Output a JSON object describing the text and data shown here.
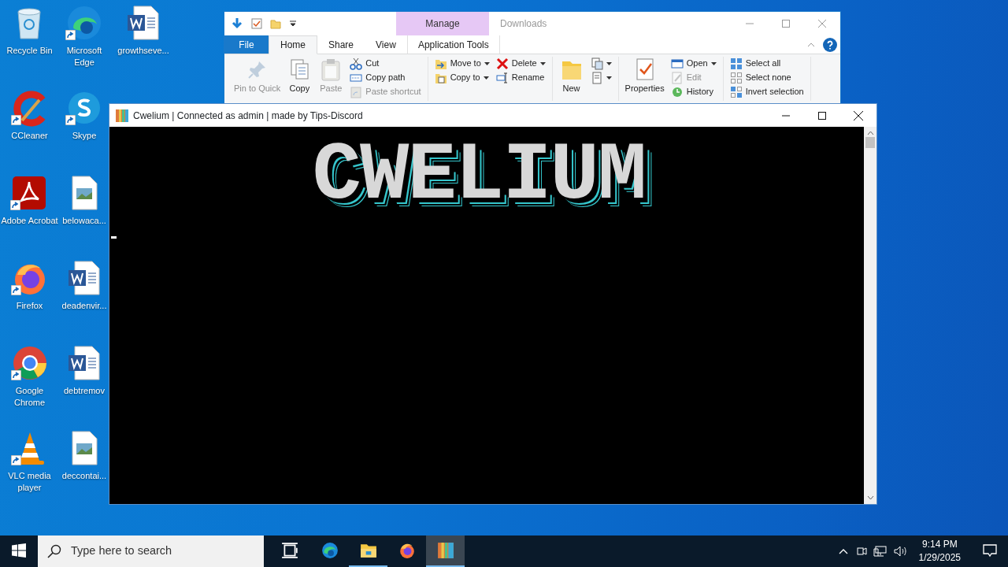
{
  "desktop_icons": [
    {
      "label": "Recycle Bin",
      "kind": "recycle",
      "shortcut": false
    },
    {
      "label": "CCleaner",
      "kind": "ccleaner",
      "shortcut": true
    },
    {
      "label": "Adobe Acrobat",
      "kind": "acrobat",
      "shortcut": true
    },
    {
      "label": "Firefox",
      "kind": "firefox",
      "shortcut": true
    },
    {
      "label": "Google Chrome",
      "kind": "chrome",
      "shortcut": true
    },
    {
      "label": "VLC media player",
      "kind": "vlc",
      "shortcut": true
    },
    {
      "label": "Microsoft Edge",
      "kind": "edge",
      "shortcut": true
    },
    {
      "label": "Skype",
      "kind": "skype",
      "shortcut": true
    },
    {
      "label": "belowaca...",
      "kind": "image",
      "shortcut": false
    },
    {
      "label": "deadenvir...",
      "kind": "word",
      "shortcut": false
    },
    {
      "label": "debtremov",
      "kind": "word",
      "shortcut": false
    },
    {
      "label": "deccontai...",
      "kind": "image",
      "shortcut": false
    },
    {
      "label": "growthseve...",
      "kind": "word",
      "shortcut": false
    }
  ],
  "explorer": {
    "title": "Downloads",
    "context_header": "Manage",
    "tabs": [
      {
        "label": "File",
        "kind": "file",
        "selected": false
      },
      {
        "label": "Home",
        "kind": "tab",
        "selected": true
      },
      {
        "label": "Share",
        "kind": "tab",
        "selected": false
      },
      {
        "label": "View",
        "kind": "tab",
        "selected": false
      },
      {
        "label": "Application Tools",
        "kind": "context",
        "selected": false
      }
    ],
    "groups": [
      {
        "columns": [
          [
            {
              "label": "Pin to Quick",
              "kind": "pin",
              "disabled": true,
              "dropdown": false
            }
          ],
          [
            {
              "label": "Copy",
              "kind": "copy",
              "disabled": false,
              "dropdown": false
            }
          ],
          [
            {
              "label": "Paste",
              "kind": "paste",
              "disabled": true,
              "dropdown": false
            }
          ],
          [
            {
              "label": "Cut",
              "kind": "cut",
              "disabled": false,
              "dropdown": false
            },
            {
              "label": "Copy path",
              "kind": "copypath",
              "disabled": false,
              "dropdown": false
            },
            {
              "label": "Paste shortcut",
              "kind": "pasteshortcut",
              "disabled": true,
              "dropdown": false
            }
          ]
        ]
      },
      {
        "columns": [
          [
            {
              "label": "Move to",
              "kind": "moveto",
              "disabled": false,
              "dropdown": true
            },
            {
              "label": "Copy to",
              "kind": "copyto",
              "disabled": false,
              "dropdown": true
            }
          ],
          [
            {
              "label": "Delete",
              "kind": "delete",
              "disabled": false,
              "dropdown": true
            },
            {
              "label": "Rename",
              "kind": "rename",
              "disabled": false,
              "dropdown": false
            }
          ]
        ]
      },
      {
        "columns": [
          [
            {
              "label": "New",
              "kind": "folder",
              "disabled": false,
              "dropdown": false
            }
          ],
          [
            {
              "kind": "newitem",
              "disabled": false,
              "dropdown": true
            },
            {
              "kind": "easyaccess",
              "disabled": false,
              "dropdown": true
            }
          ]
        ]
      },
      {
        "columns": [
          [
            {
              "label": "Properties",
              "kind": "properties",
              "disabled": false,
              "dropdown": false
            }
          ],
          [
            {
              "label": "Open",
              "kind": "open",
              "disabled": false,
              "dropdown": true
            },
            {
              "label": "Edit",
              "kind": "edit",
              "disabled": true,
              "dropdown": false
            },
            {
              "label": "History",
              "kind": "history",
              "disabled": false,
              "dropdown": false
            }
          ]
        ]
      },
      {
        "columns": [
          [
            {
              "label": "Select all",
              "kind": "selectall",
              "disabled": false,
              "dropdown": false
            },
            {
              "label": "Select none",
              "kind": "selectnone",
              "disabled": false,
              "dropdown": false
            },
            {
              "label": "Invert selection",
              "kind": "invert",
              "disabled": false,
              "dropdown": false
            }
          ]
        ]
      }
    ]
  },
  "console": {
    "title": "Cwelium | Connected as admin | made by Tips-Discord",
    "banner": "CWELIUM"
  },
  "taskbar": {
    "search_placeholder": "Type here to search",
    "apps": [
      {
        "kind": "taskview",
        "running": false,
        "selected": false
      },
      {
        "kind": "edge",
        "running": false,
        "selected": false
      },
      {
        "kind": "explorer",
        "running": true,
        "selected": false
      },
      {
        "kind": "firefox",
        "running": false,
        "selected": false
      },
      {
        "kind": "cwelium",
        "running": true,
        "selected": true
      }
    ],
    "time": "9:14 PM",
    "date": "1/29/2025"
  }
}
